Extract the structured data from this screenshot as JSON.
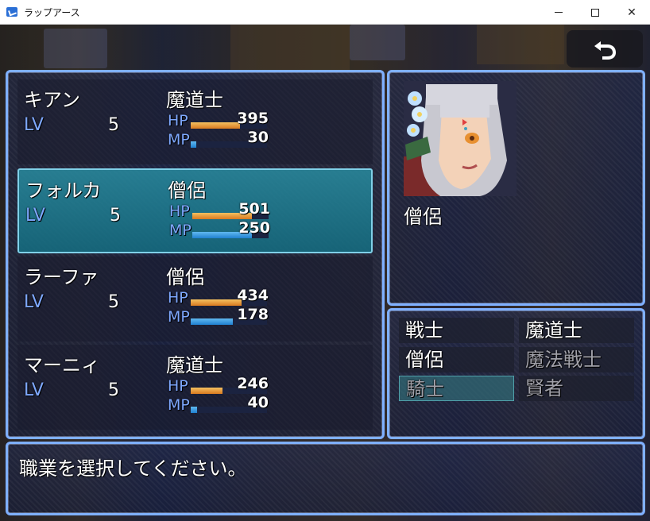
{
  "window": {
    "title": "ラップアース",
    "minimize": "–",
    "maximize": "□",
    "close": "✕"
  },
  "colors": {
    "panel_border": "#7fb0ff",
    "label_blue": "#7ea8ff",
    "hp_gauge": "#e89a3a",
    "mp_gauge": "#3a9ae0",
    "selected_row": "#1f8ca0"
  },
  "back_button": {
    "icon": "undo-arrow-icon"
  },
  "party": [
    {
      "name": "キアン",
      "class": "魔道士",
      "lv_label": "LV",
      "lv": "5",
      "hp_label": "HP",
      "hp": "395",
      "hp_ratio": 0.65,
      "mp_label": "MP",
      "mp": "30",
      "mp_ratio": 0.07
    },
    {
      "name": "フォルカ",
      "class": "僧侶",
      "lv_label": "LV",
      "lv": "5",
      "hp_label": "HP",
      "hp": "501",
      "hp_ratio": 0.78,
      "mp_label": "MP",
      "mp": "250",
      "mp_ratio": 0.78
    },
    {
      "name": "ラーファ",
      "class": "僧侶",
      "lv_label": "LV",
      "lv": "5",
      "hp_label": "HP",
      "hp": "434",
      "hp_ratio": 0.67,
      "mp_label": "MP",
      "mp": "178",
      "mp_ratio": 0.55
    },
    {
      "name": "マーニィ",
      "class": "魔道士",
      "lv_label": "LV",
      "lv": "5",
      "hp_label": "HP",
      "hp": "246",
      "hp_ratio": 0.42,
      "mp_label": "MP",
      "mp": "40",
      "mp_ratio": 0.08
    }
  ],
  "selected_member": 1,
  "preview": {
    "portrait_icon": "character-portrait",
    "class_name": "僧侶"
  },
  "classes": [
    {
      "label": "戦士",
      "enabled": true
    },
    {
      "label": "魔道士",
      "enabled": true
    },
    {
      "label": "僧侶",
      "enabled": true
    },
    {
      "label": "魔法戦士",
      "enabled": false
    },
    {
      "label": "騎士",
      "enabled": false
    },
    {
      "label": "賢者",
      "enabled": false
    }
  ],
  "help": {
    "text": "職業を選択してください。"
  }
}
